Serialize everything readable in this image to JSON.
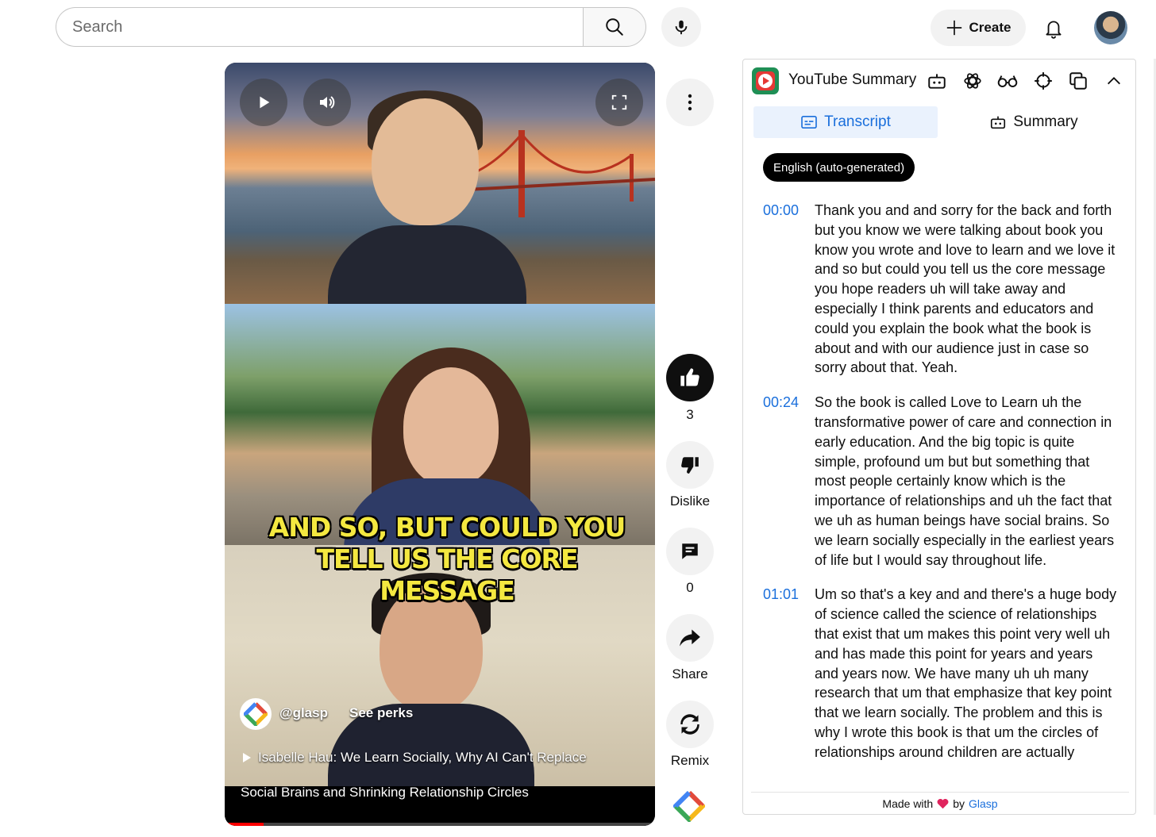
{
  "topbar": {
    "search_placeholder": "Search",
    "create_label": "Create"
  },
  "video": {
    "caption_line1": "AND SO, BUT COULD YOU",
    "caption_line2": "TELL US THE CORE MESSAGE",
    "channel": "@glasp",
    "see_perks": "See perks",
    "title_line1": "Isabelle Hau: We Learn Socially, Why AI Can't Replace",
    "title_line2": "Social Brains and Shrinking Relationship Circles",
    "progress_fraction": 0.09
  },
  "actions": {
    "like_count": "3",
    "dislike_label": "Dislike",
    "comment_count": "0",
    "share_label": "Share",
    "remix_label": "Remix"
  },
  "extension": {
    "title": "YouTube Summary",
    "tab_transcript": "Transcript",
    "tab_summary": "Summary",
    "language": "English (auto-generated)",
    "segments": [
      {
        "time": "00:00",
        "text": "Thank you and and sorry for the back and forth but you know we were talking about book you know you wrote and love to learn and we love it and so but could you tell us the core message you hope readers uh will take away and especially I think parents and educators and could you explain the book what the book is about and with our audience just in case so sorry about that. Yeah."
      },
      {
        "time": "00:24",
        "text": "So the book is called Love to Learn uh the transformative power of care and connection in early education. And the big topic is quite simple, profound um but but something that most people certainly know which is the importance of relationships and uh the fact that we uh as human beings have social brains. So we learn socially especially in the earliest years of life but I would say throughout life."
      },
      {
        "time": "01:01",
        "text": "Um so that's a key and and there's a huge body of science called the science of relationships that exist that um makes this point very well uh and has made this point for years and years and years now. We have many uh uh many research that um that emphasize that key point that we learn socially. The problem and this is why I wrote this book is that um the circles of relationships around children are actually"
      }
    ],
    "footer_made_with": "Made with",
    "footer_by": "by",
    "footer_glasp": "Glasp"
  },
  "colors": {
    "accent_blue": "#1a6fdc",
    "caption_yellow": "#f4e840",
    "progress_red": "#ff0000",
    "heart_red": "#e0245e"
  }
}
